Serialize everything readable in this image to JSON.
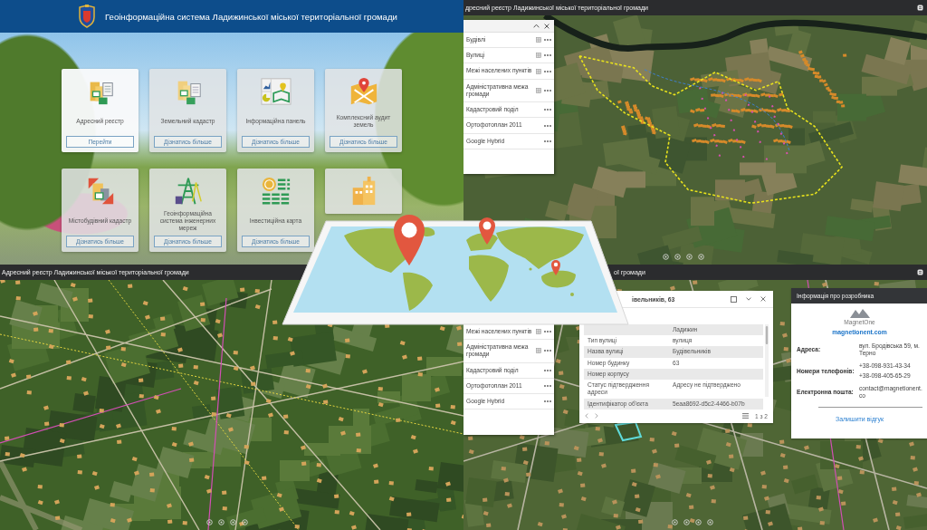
{
  "portal": {
    "header": {
      "title": "Геоінформаційна система Ладижинської міської територіальної громади"
    },
    "tiles": [
      {
        "kind": "address",
        "label": "Адресний реєстр",
        "button": "Перейти",
        "selected": true
      },
      {
        "kind": "land",
        "label": "Земельний кадастр",
        "button": "Дізнатись більше",
        "selected": false
      },
      {
        "kind": "dashboard",
        "label": "Інформаційна панель",
        "button": "Дізнатись більше",
        "selected": false
      },
      {
        "kind": "audit",
        "label": "Комплексний аудит земель",
        "button": "Дізнатись більше",
        "selected": false
      },
      {
        "kind": "urban",
        "label": "Містобудівний кадастр",
        "button": "Дізнатись більше",
        "selected": false
      },
      {
        "kind": "networks",
        "label": "Геоінформаційна система інженерних мереж",
        "button": "Дізнатись більше",
        "selected": false
      },
      {
        "kind": "investment",
        "label": "Інвестиційна карта",
        "button": "Дізнатись більше",
        "selected": false
      },
      {
        "kind": "city",
        "selected": false
      }
    ]
  },
  "overview_map": {
    "header": {
      "title": "дресний реєстр Ладижинської міської територіальної громади"
    },
    "layers_panel": {
      "layers": [
        {
          "name": "Будівлі",
          "legend": true
        },
        {
          "name": "Вулиці",
          "legend": true
        },
        {
          "name": "Межі населених пунктів",
          "legend": true
        },
        {
          "name": "Адміністративна межа громади",
          "legend": true
        },
        {
          "name": "Кадастровий поділ",
          "legend": false
        },
        {
          "name": "Ортофотоплан 2011",
          "legend": false
        },
        {
          "name": "Google Hybrid",
          "legend": false
        }
      ]
    }
  },
  "street_map": {
    "header": {
      "title": "Адресний реєстр Ладижинської міської територіальної громади"
    }
  },
  "detail_map": {
    "header": {
      "title": "ої громади"
    },
    "layers_panel": {
      "layers": [
        {
          "name": "Межі населених пунктів",
          "legend": true
        },
        {
          "name": "Адміністративна межа громади",
          "legend": true
        },
        {
          "name": "Кадастровий поділ",
          "legend": false
        },
        {
          "name": "Ортофотоплан 2011",
          "legend": false
        },
        {
          "name": "Google Hybrid",
          "legend": false
        }
      ]
    },
    "popup": {
      "title": "івельників, 63",
      "rows": [
        {
          "value": "Ладижин"
        },
        {
          "label": "Тип вулиці",
          "value": "вулиця"
        },
        {
          "label": "Назва вулиці",
          "value": "Будівельників"
        },
        {
          "label": "Номер будинку",
          "value": "63"
        },
        {
          "label": "Номер корпусу"
        },
        {
          "label": "Статус підтвердження адреси",
          "value": "Адресу не підтверджено"
        },
        {
          "label": "Ідентифікатор об'єкта",
          "value": "5eaa8692-d5c2-4466-b07b"
        }
      ],
      "pager": "1 з 2"
    },
    "developer_info": {
      "title": "Інформація про розробника",
      "logo": "MagnetOne",
      "website": "magnetionent.com",
      "fields": [
        {
          "label": "Адреса:",
          "values": [
            "вул. Бродівська 59, м. Терно"
          ]
        },
        {
          "label": "Номери телефонів:",
          "values": [
            "+38-098-931-43-34",
            "+38-098-405-65-29"
          ]
        },
        {
          "label": "Електронна пошта:",
          "values": [
            "contact@magnetionent.co"
          ]
        }
      ],
      "feedback_link": "Залишити відгук"
    }
  }
}
